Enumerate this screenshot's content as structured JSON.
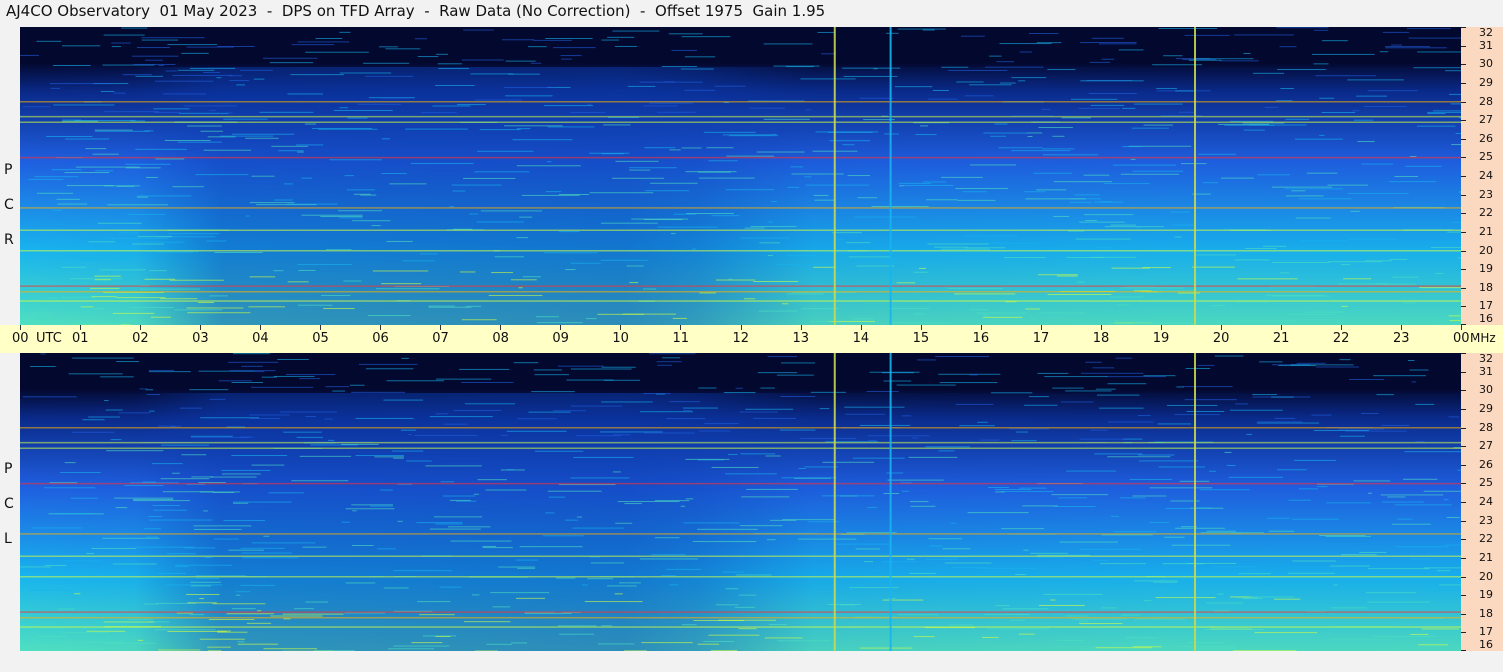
{
  "title": "AJ4CO Observatory  01 May 2023  -  DPS on TFD Array  -  Raw Data (No Correction)  -  Offset 1975  Gain 1.95",
  "panels": [
    {
      "id": "rcp",
      "letters": [
        "R",
        "C",
        "P"
      ]
    },
    {
      "id": "lcp",
      "letters": [
        "L",
        "C",
        "P"
      ]
    }
  ],
  "time_axis": {
    "utc_label": "UTC",
    "unit_label": "MHz",
    "tick_labels": [
      "00",
      "01",
      "02",
      "03",
      "04",
      "05",
      "06",
      "07",
      "08",
      "09",
      "10",
      "11",
      "12",
      "13",
      "14",
      "15",
      "16",
      "17",
      "18",
      "19",
      "20",
      "21",
      "22",
      "23",
      "00"
    ]
  },
  "freq_axis": {
    "tick_labels": [
      "16",
      "17",
      "18",
      "19",
      "20",
      "21",
      "22",
      "23",
      "24",
      "25",
      "26",
      "27",
      "28",
      "29",
      "30",
      "31",
      "32"
    ]
  },
  "colors": {
    "background": "#0a2a8a",
    "time_axis_bg": "#ffffc6",
    "freq_axis_bg": "#fbd9c0",
    "colormap": [
      "#03082e",
      "#0a2a8a",
      "#1f5fe0",
      "#18b4ee",
      "#4fe0c0",
      "#d4ff40",
      "#ffb000",
      "#ff3030"
    ]
  },
  "chart_data": {
    "type": "heatmap",
    "title": "AJ4CO Observatory  01 May 2023  -  DPS on TFD Array  -  Raw Data (No Correction)  -  Offset 1975  Gain 1.95",
    "x_range_utc_hours": [
      0,
      24
    ],
    "y_range_mhz": [
      16,
      32
    ],
    "series": [
      {
        "name": "RCP",
        "bright_rows_mhz": [
          17.3,
          17.8,
          18.1,
          20.0,
          21.1,
          22.3,
          25.0,
          26.9,
          27.2,
          28.0
        ],
        "vertical_lines_utc": [
          13.57,
          14.5,
          19.57
        ]
      },
      {
        "name": "LCP",
        "bright_rows_mhz": [
          17.3,
          17.8,
          18.1,
          20.0,
          21.1,
          22.3,
          25.0,
          26.9,
          27.2,
          28.0
        ],
        "vertical_lines_utc": [
          13.57,
          14.5,
          19.57
        ]
      }
    ]
  }
}
